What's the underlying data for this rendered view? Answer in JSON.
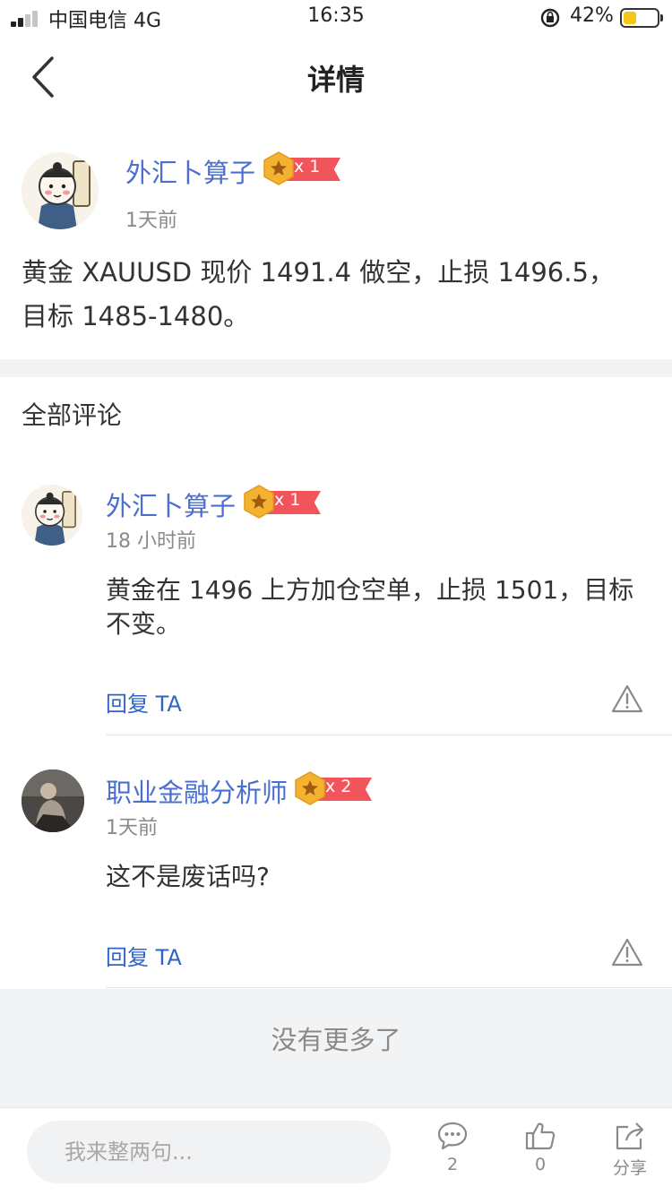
{
  "status_bar": {
    "carrier": "中国电信 4G",
    "time": "16:35",
    "battery_percent": "42%",
    "battery_level": 0.42
  },
  "nav": {
    "title": "详情"
  },
  "post": {
    "author": "外汇卜算子",
    "badge_multiplier": "x 1",
    "time": "1天前",
    "content_line1": "黄金 XAUUSD 现价 1491.4 做空，止损 1496.5，",
    "content_line2": "目标 1485-1480。"
  },
  "comments_section": {
    "title": "全部评论",
    "items": [
      {
        "author": "外汇卜算子",
        "badge_multiplier": "x 1",
        "time": "18 小时前",
        "content_line1": "黄金在 1496 上方加仓空单，止损 1501，目标",
        "content_line2": "不变。",
        "reply_label": "回复 TA"
      },
      {
        "author": "职业金融分析师",
        "badge_multiplier": "x 2",
        "time": "1天前",
        "content_line1": "这不是废话吗?",
        "content_line2": "",
        "reply_label": "回复 TA"
      }
    ],
    "no_more": "没有更多了"
  },
  "bottom_bar": {
    "input_placeholder": "我来整两句...",
    "comment_count": "2",
    "like_count": "0",
    "share_label": "分享"
  },
  "colors": {
    "username": "#4a6fd1",
    "reply": "#2f63c9",
    "badge_gold": "#f3b331",
    "badge_red": "#f1545b",
    "battery_fill": "#f5c518"
  },
  "icons": [
    "back-chevron-icon",
    "lock-rotation-icon",
    "star-badge-icon",
    "warning-triangle-icon",
    "chat-bubble-icon",
    "thumbs-up-icon",
    "share-icon"
  ]
}
